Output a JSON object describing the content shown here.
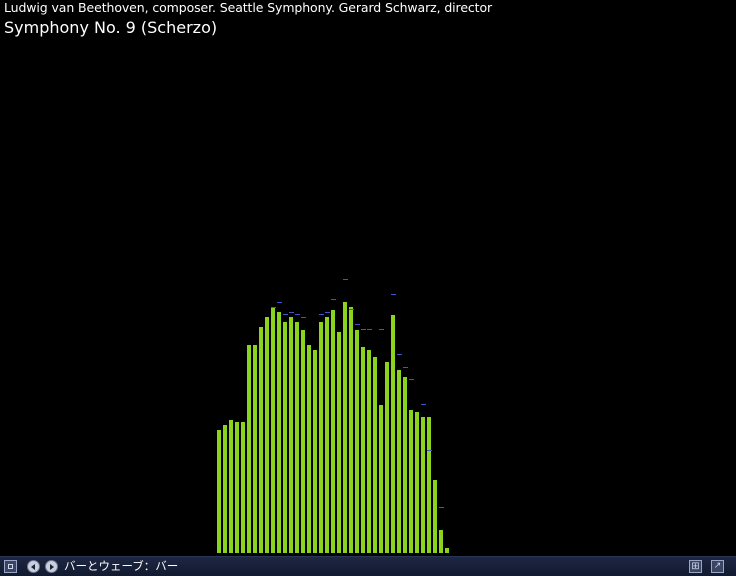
{
  "now_playing": {
    "artist_line": "Ludwig van Beethoven, composer. Seattle Symphony. Gerard Schwarz, director",
    "track_title": "Symphony No. 9 (Scherzo)"
  },
  "visualizer": {
    "mode": "bars",
    "max_level": 100,
    "bar_color": "#8ad41e",
    "peak_color": "#3c55d0",
    "levels": [
      49,
      51,
      53,
      52,
      52,
      83,
      83,
      90,
      94,
      98,
      96,
      92,
      94,
      92,
      89,
      83,
      81,
      92,
      94,
      97,
      88,
      100,
      98,
      89,
      82,
      81,
      78,
      59,
      76,
      95,
      73,
      70,
      57,
      56,
      54,
      54,
      29,
      9,
      2
    ],
    "peaks": [
      0,
      0,
      0,
      0,
      0,
      0,
      0,
      0,
      0,
      97,
      99,
      94,
      95,
      94,
      93,
      0,
      0,
      94,
      95,
      100,
      0,
      108,
      96,
      90,
      88,
      88,
      0,
      88,
      0,
      102,
      78,
      73,
      68,
      0,
      58,
      40,
      0,
      17,
      0
    ]
  },
  "statusbar": {
    "mode_label": "バーとウェーブ：バー"
  }
}
